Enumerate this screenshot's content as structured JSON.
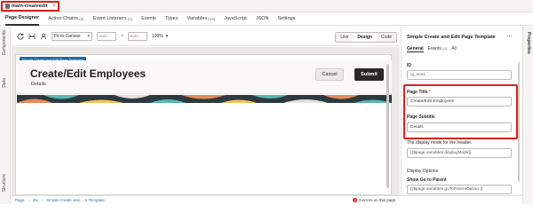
{
  "file_tab": {
    "label": "main-createedit",
    "close": "×"
  },
  "designer_tabs": [
    {
      "label": "Page Designer",
      "count": ""
    },
    {
      "label": "Action Chains",
      "count": "(6)"
    },
    {
      "label": "Event Listeners",
      "count": "(4)"
    },
    {
      "label": "Events",
      "count": ""
    },
    {
      "label": "Types",
      "count": ""
    },
    {
      "label": "Variables",
      "count": "(15)"
    },
    {
      "label": "JavaScript",
      "count": ""
    },
    {
      "label": "JSON",
      "count": ""
    },
    {
      "label": "Settings",
      "count": ""
    }
  ],
  "left_rail": {
    "components": "Components",
    "data": "Data",
    "structure": "Structure"
  },
  "right_rail": {
    "properties": "Properties"
  },
  "toolbar": {
    "fit_to_canvas": "Fit to Canvas",
    "width_placeholder": "auto",
    "height_placeholder": "auto",
    "times": "×",
    "zoom": "100%",
    "modes": [
      "Live",
      "Design",
      "Code"
    ],
    "active_mode": "Design"
  },
  "canvas": {
    "template_badge": "Simple Create and Edit Page Template",
    "page_title": "Create/Edit Employees",
    "page_subtitle": "Details",
    "cancel_label": "Cancel",
    "submit_label": "Submit"
  },
  "statusbar": {
    "crumbs": [
      "Page",
      "div",
      "Simple Create and ... e Template"
    ],
    "errors": "2 errors on this page",
    "error_count": "2"
  },
  "properties": {
    "title": "Simple Create and Edit Page Template",
    "more": "⋯",
    "tabs": [
      {
        "label": "General",
        "count": ""
      },
      {
        "label": "Events",
        "count": "(4)"
      },
      {
        "label": "All",
        "count": ""
      }
    ],
    "id_label": "ID",
    "id_value": "oj_oce1",
    "page_title_label": "Page Title",
    "page_title_required": "*",
    "page_title_value": "Create/Edit Employees",
    "page_subtitle_label": "Page Subtitle",
    "page_subtitle_value": "Details",
    "display_mode_label": "The display mode for the header.",
    "display_mode_value": "{{$page.variables.displayMode}}",
    "display_options_label": "Display Options",
    "show_go_to_parent_label": "Show Go to Parent",
    "show_go_to_parent_value": "{{$page.variables.goToParentOption }}"
  },
  "colors": {
    "highlight": "#d9211f",
    "badge": "#1c6fa3",
    "submit": "#2a2928"
  }
}
